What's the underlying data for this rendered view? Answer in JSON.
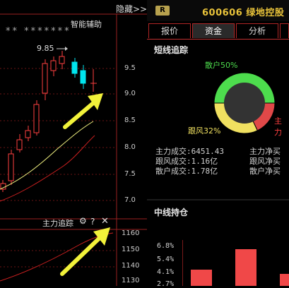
{
  "chart": {
    "hide_label": "隐藏>>",
    "stars": "** *******",
    "assist_label": "智能辅助",
    "peak_label": "9.85",
    "y_labels": [
      "9.5",
      "9.0",
      "8.5",
      "8.0",
      "7.5",
      "7.0"
    ],
    "sub_title": "主力追踪",
    "sub_y_labels": [
      "1160",
      "1150",
      "1140",
      "1130"
    ],
    "icons": {
      "gear": "gear-icon",
      "help": "question-icon",
      "close": "close-icon"
    }
  },
  "stock": {
    "badge": "R",
    "code": "600606",
    "name": "绿地控股"
  },
  "tabs": [
    {
      "label": "报价",
      "active": false
    },
    {
      "label": "资金",
      "active": true
    },
    {
      "label": "分析",
      "active": false
    }
  ],
  "short_term": {
    "title": "短线追踪",
    "retail_label": "散户50%",
    "follow_label": "跟风32%",
    "main_label": "主力",
    "pie": [
      {
        "name": "散户",
        "percent": 50,
        "color": "#4ddc4d"
      },
      {
        "name": "主力",
        "percent": 18,
        "color": "#e04848"
      },
      {
        "name": "跟风",
        "percent": 32,
        "color": "#f0e060"
      }
    ],
    "stats_left": [
      "主力成交:6451.43",
      "跟风成交:1.16亿",
      "散户成交:1.78亿"
    ],
    "stats_right": [
      "主力净买",
      "跟风净买",
      "散户净买"
    ]
  },
  "mid_term": {
    "title": "中线持仓",
    "y_labels": [
      "6.8%",
      "5.4%",
      "4.1%",
      "2.7%"
    ]
  },
  "colors": {
    "up": "#ff4040",
    "down": "#00e5ee",
    "ma_yellow": "#f0f080",
    "ma_red": "#cc2020",
    "grid": "#7a1a1a",
    "arrow": "#f2f23a"
  }
}
